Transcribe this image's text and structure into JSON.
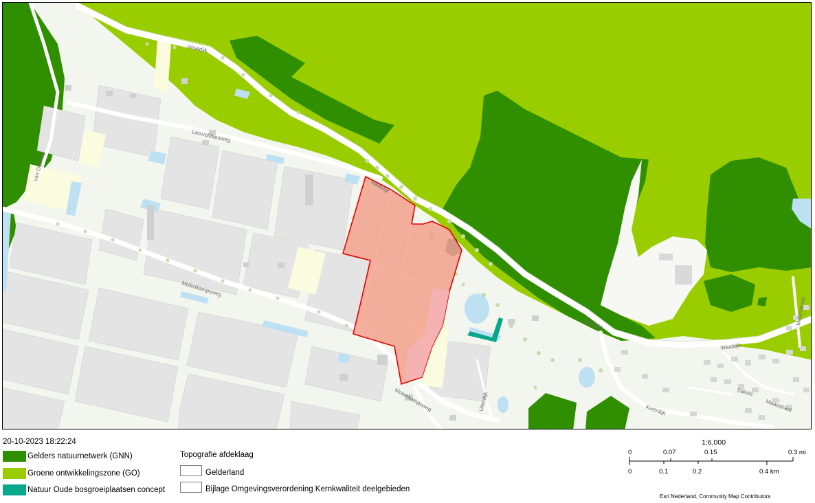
{
  "timestamp": "20-10-2023 18:22:24",
  "legend": {
    "items": [
      {
        "label": "Gelders natuurnetwerk (GNN)",
        "color": "#2f8f00"
      },
      {
        "label": "Groene ontwikkelingszone (GO)",
        "color": "#9acd00"
      },
      {
        "label": "Natuur Oude bosgroeiplaatsen concept",
        "color": "#0aa88a"
      }
    ],
    "topo_title": "Topografie afdeklaag",
    "topo_items": [
      {
        "label": "Gelderland"
      },
      {
        "label": "Bijlage Omgevingsverordening Kernkwaliteit deelgebieden"
      }
    ]
  },
  "scale": {
    "ratio": "1:6,000",
    "mi_ticks": [
      "0",
      "0.07",
      "0.15",
      "0.3 mi"
    ],
    "km_ticks": [
      "0",
      "0.1",
      "0.2",
      "0.4 km"
    ]
  },
  "attribution": "Esri Nederland, Community Map Contributors",
  "map": {
    "road_labels": {
      "waalbandijk_top": "Waaldijk",
      "liesveldsesteeg": "Liesveldsesteeg",
      "waaldijk_mid": "Waaldijk",
      "molenkampsweg_left": "Molenkampsweg",
      "molenkampsweg_bottom": "Molenkampsweg",
      "waaldijk_right": "Waaldijk",
      "waaldijk_far": "Waaldijk",
      "kwerdijk": "Kwerdijk",
      "uiterdijk": "Uiterdijk",
      "stiksie": "Stiksie",
      "vandijk": "van Dijkweg",
      "maasstraat": "Maasstraat",
      "molenstraat": "Molenstraat"
    },
    "colors": {
      "gnn": "#2f8f00",
      "go": "#9acd00",
      "oude_bos": "#0aa88a",
      "plan_area_fill": "#f2a08c",
      "plan_area_stroke": "#e00000",
      "water": "#bde0f2"
    }
  }
}
